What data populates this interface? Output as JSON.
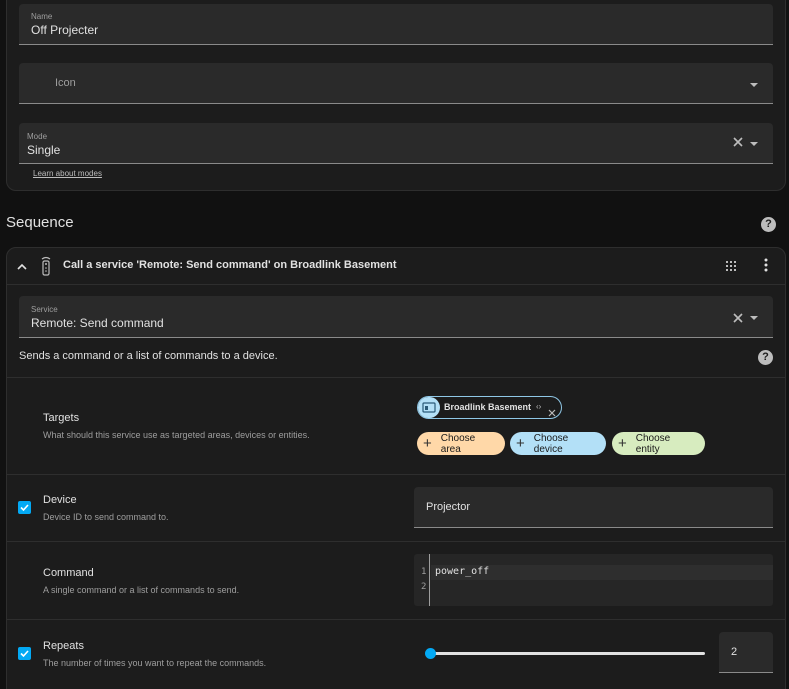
{
  "top_card": {
    "name_label": "Name",
    "name_value": "Off Projecter",
    "icon_placeholder": "Icon",
    "mode_label": "Mode",
    "mode_value": "Single",
    "learn_link": "Learn about modes"
  },
  "sequence": {
    "heading": "Sequence"
  },
  "action": {
    "title": "Call a service 'Remote: Send command' on Broadlink Basement",
    "service_label": "Service",
    "service_value": "Remote: Send command",
    "service_description": "Sends a command or a list of commands to a device.",
    "targets": {
      "title": "Targets",
      "description": "What should this service use as targeted areas, devices or entities.",
      "selected_chip": "Broadlink Basement",
      "choose_area": "Choose area",
      "choose_device": "Choose device",
      "choose_entity": "Choose entity"
    },
    "device": {
      "title": "Device",
      "description": "Device ID to send command to.",
      "value": "Projector",
      "checked": true
    },
    "command": {
      "title": "Command",
      "description": "A single command or a list of commands to send.",
      "line_numbers": [
        "1",
        "2"
      ],
      "lines": [
        "power_off",
        ""
      ]
    },
    "repeats": {
      "title": "Repeats",
      "description": "The number of times you want to repeat the commands.",
      "value": "2",
      "slider_fraction": 0,
      "checked": true
    }
  },
  "colors": {
    "accent": "#03a9f4",
    "chip_area": "#ffd8a8",
    "chip_device": "#b3e0f7",
    "chip_entity": "#d7ecbf"
  }
}
